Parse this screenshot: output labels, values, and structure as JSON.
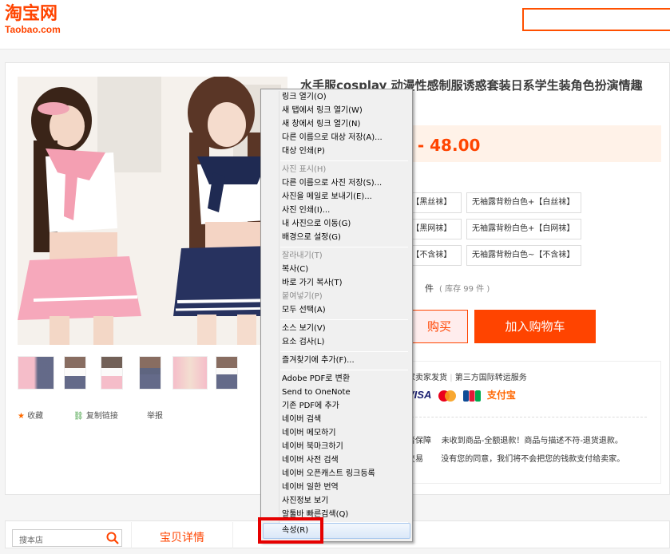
{
  "header": {
    "logo_cn": "淘宝网",
    "logo_en": "Taobao.com"
  },
  "product": {
    "title": "水手服cosplay 动漫性感制服诱惑套装日系学生装角色扮演情趣短裙",
    "price": "0 - 48.00",
    "sku_options": [
      "+【黑丝袜】",
      "无袖露背粉白色+【白丝袜】",
      "+【黑网袜】",
      "无袖露背粉白色+【白网袜】",
      "~【不含袜】",
      "无袖露背粉白色~【不含袜】"
    ],
    "qty_unit": "件",
    "stock": "( 库存 99 件 )",
    "buy_label": "购买",
    "cart_label": "加入购物车",
    "actions": {
      "favorite": "收藏",
      "copy_link": "复制链接",
      "report": "举报"
    }
  },
  "service": {
    "line1_a": "家卖家发货",
    "line1_b": "第三方国际转运服务",
    "pay_visa": "VISA",
    "pay_alipay": "支付宝",
    "guarantee_a": "者保障",
    "guarantee_b": "未收到商品-全额退款！商品与描述不符-退货退款。",
    "trade_a": "交易",
    "trade_b": "没有您的同意，我们将不会把您的钱款支付给卖家。"
  },
  "bottom": {
    "shop_search_placeholder": "搜本店",
    "tab_details": "宝贝详情"
  },
  "context_menu": {
    "items": [
      "링크 열기(O)",
      "새 탭에서 링크 열기(W)",
      "새 창에서 링크 열기(N)",
      "다른 이름으로 대상 저장(A)...",
      "대상 인쇄(P)",
      "사진 표시(H)",
      "다른 이름으로 사진 저장(S)...",
      "사진을 메일로 보내기(E)...",
      "사진 인쇄(I)...",
      "내 사진으로 이동(G)",
      "배경으로 설정(G)",
      "잘라내기(T)",
      "복사(C)",
      "바로 가기 복사(T)",
      "붙여넣기(P)",
      "모두 선택(A)",
      "소스 보기(V)",
      "요소 검사(L)",
      "즐겨찾기에 추가(F)...",
      "Adobe PDF로 변환",
      "Send to OneNote",
      "기존 PDF에 추가",
      "네이버 검색",
      "네이버 메모하기",
      "네이버 북마크하기",
      "네이버 사전 검색",
      "네이버 오픈캐스트 링크등록",
      "네이버 일한 번역",
      "사진정보 보기",
      "알툴바 빠른검색(Q)",
      "속성(R)"
    ]
  },
  "colors": {
    "brand": "#ff4400",
    "highlight_box": "#e60000"
  }
}
